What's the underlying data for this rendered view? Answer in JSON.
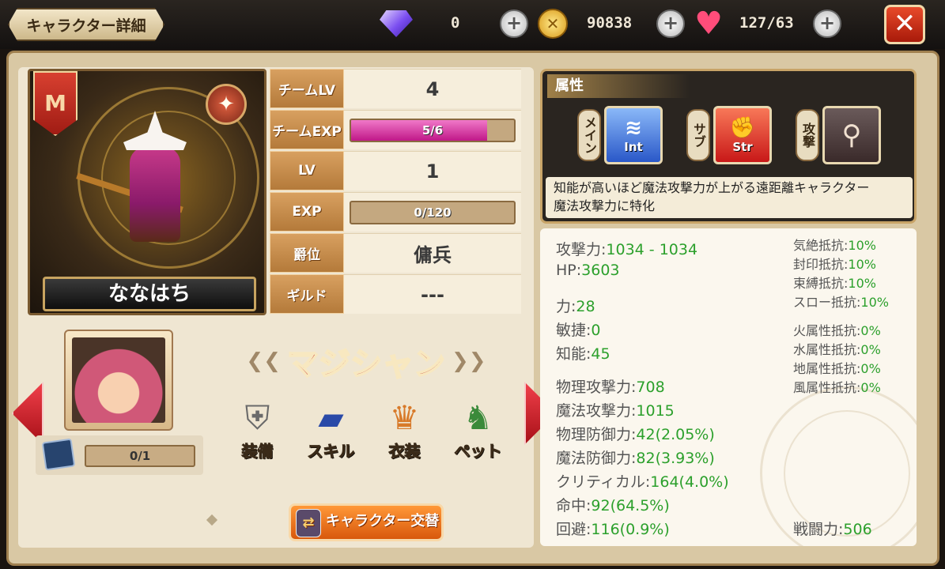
{
  "header": {
    "title": "キャラクター詳細",
    "gems": "0",
    "gold": "90838",
    "stamina": "127/63",
    "close_label": "✕"
  },
  "character": {
    "name": "ななはち",
    "class_name": "マジシャン",
    "team_lv_label": "チームLV",
    "team_lv": "4",
    "team_exp_label": "チームEXP",
    "team_exp": "5/6",
    "team_exp_fraction": 0.833,
    "lv_label": "LV",
    "lv": "1",
    "exp_label": "EXP",
    "exp": "0/120",
    "exp_fraction": 0.0,
    "rank_label": "爵位",
    "rank": "傭兵",
    "guild_label": "ギルド",
    "guild": "---",
    "cards": "0/1"
  },
  "menu": {
    "equip": "装備",
    "skill": "スキル",
    "costume": "衣装",
    "pet": "ペット",
    "swap": "キャラクター交替"
  },
  "attributes": {
    "title": "属性",
    "main_tag": "メイン",
    "sub_tag": "サブ",
    "attack_tag": "攻撃",
    "main_abbr": "Int",
    "sub_abbr": "Str",
    "description_1": "知能が高いほど魔法攻撃力が上がる遠距離キャラクター",
    "description_2": "魔法攻撃力に特化"
  },
  "stats": {
    "atk_k": "攻撃力:",
    "atk_v": "1034 - 1034",
    "hp_k": "HP:",
    "hp_v": "3603",
    "str_k": "力:",
    "str_v": "28",
    "agi_k": "敏捷:",
    "agi_v": "0",
    "int_k": "知能:",
    "int_v": "45",
    "patk_k": "物理攻撃力:",
    "patk_v": "708",
    "matk_k": "魔法攻撃力:",
    "matk_v": "1015",
    "pdef_k": "物理防御力:",
    "pdef_v": "42(2.05%)",
    "mdef_k": "魔法防御力:",
    "mdef_v": "82(3.93%)",
    "crit_k": "クリティカル:",
    "crit_v": "164(4.0%)",
    "hit_k": "命中:",
    "hit_v": "92(64.5%)",
    "eva_k": "回避:",
    "eva_v": "116(0.9%)",
    "stun_k": "気絶抵抗:",
    "stun_v": "10%",
    "seal_k": "封印抵抗:",
    "seal_v": "10%",
    "bind_k": "束縛抵抗:",
    "bind_v": "10%",
    "slow_k": "スロー抵抗:",
    "slow_v": "10%",
    "fire_k": "火属性抵抗:",
    "fire_v": "0%",
    "water_k": "水属性抵抗:",
    "water_v": "0%",
    "earth_k": "地属性抵抗:",
    "earth_v": "0%",
    "wind_k": "風属性抵抗:",
    "wind_v": "0%",
    "power_k": "戦闘力:",
    "power_v": "506"
  },
  "colors": {
    "stat_value": "#2ca02c",
    "close": "#c82a14",
    "exp_bar": "#e040a8"
  }
}
